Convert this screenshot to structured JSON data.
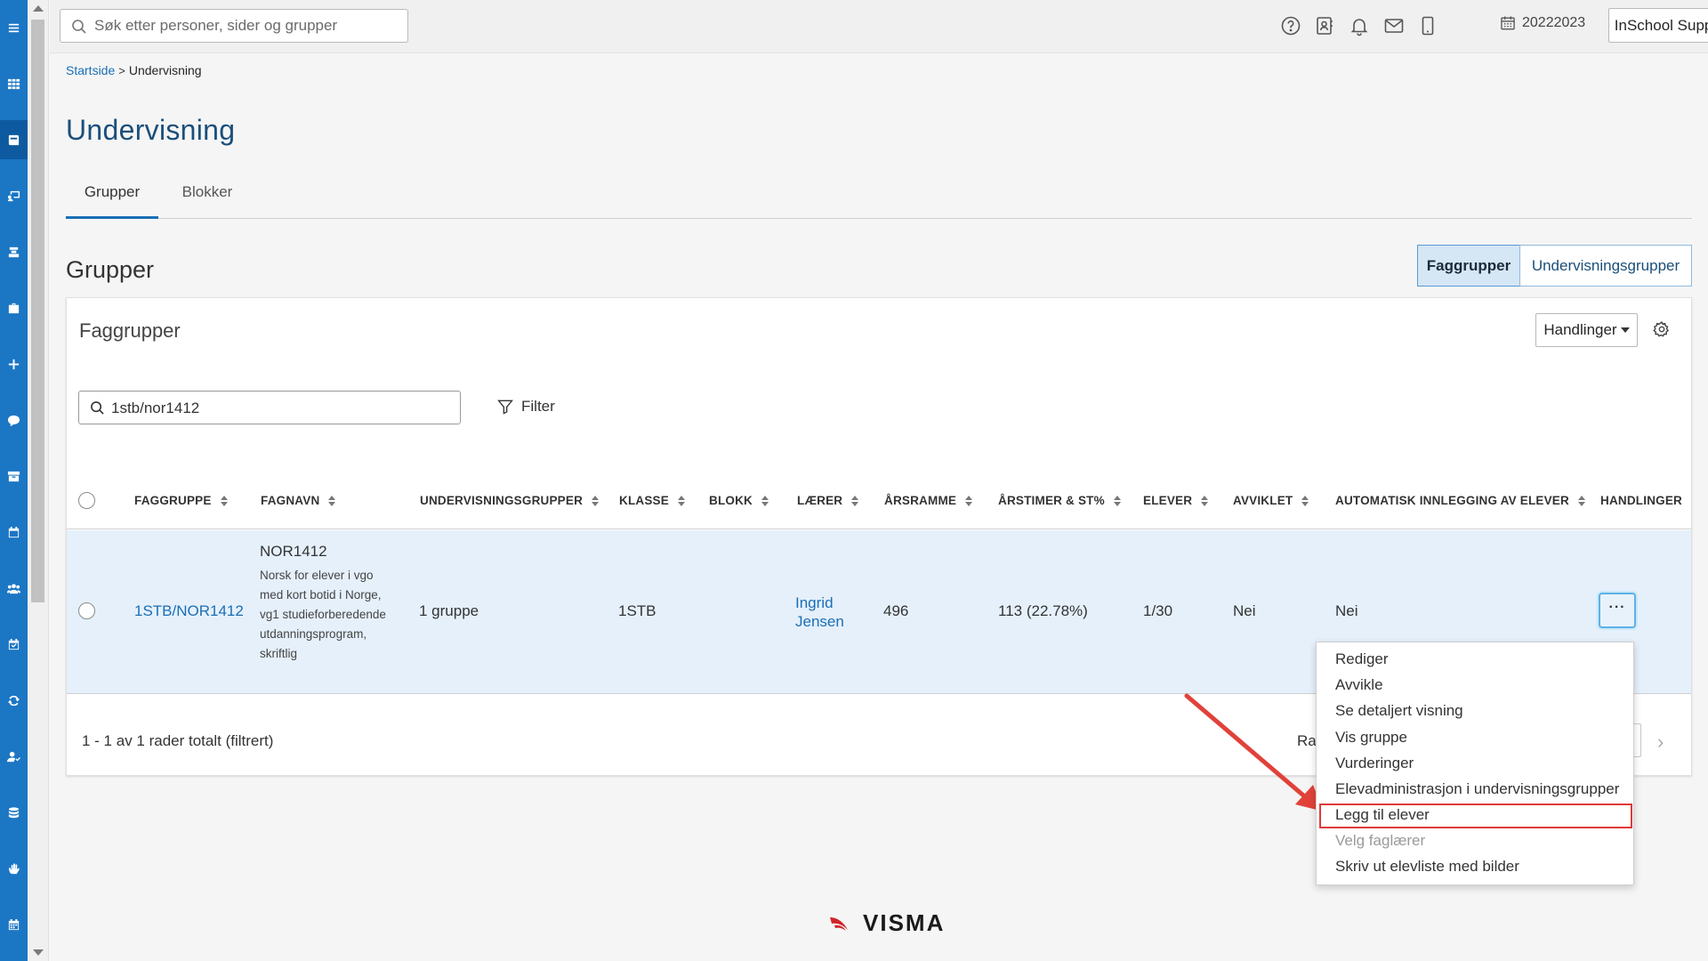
{
  "app": {
    "accent": "#1b76c4",
    "title_color": "#1b4f7a"
  },
  "rail": {
    "items": [
      {
        "icon": "menu-icon"
      },
      {
        "icon": "apps-grid-icon"
      },
      {
        "icon": "book-icon",
        "active": true
      },
      {
        "icon": "presentation-icon"
      },
      {
        "icon": "student-icon"
      },
      {
        "icon": "briefcase-icon"
      },
      {
        "icon": "plus-icon"
      },
      {
        "icon": "chat-icon"
      },
      {
        "icon": "archive-icon"
      },
      {
        "icon": "calendar-icon"
      },
      {
        "icon": "group-icon"
      },
      {
        "icon": "calendar-check-icon"
      },
      {
        "icon": "sync-icon"
      },
      {
        "icon": "user-check-icon"
      },
      {
        "icon": "database-icon"
      },
      {
        "icon": "hand-icon"
      },
      {
        "icon": "calendar-grid-icon"
      }
    ]
  },
  "topbar": {
    "search_placeholder": "Søk etter personer, sider og grupper",
    "icons": [
      "help-icon",
      "contact-card-icon",
      "bell-icon",
      "mail-icon",
      "mobile-icon",
      "calendar-icon"
    ],
    "school_year": "20222023",
    "user_label": "InSchool Support"
  },
  "breadcrumb": {
    "home": "Startside",
    "separator": ">",
    "current": "Undervisning"
  },
  "page": {
    "title": "Undervisning",
    "tabs": [
      {
        "label": "Grupper",
        "active": true
      },
      {
        "label": "Blokker",
        "active": false
      }
    ],
    "section_title": "Grupper",
    "segments": [
      {
        "label": "Faggrupper",
        "active": true
      },
      {
        "label": "Undervisningsgrupper",
        "active": false
      }
    ]
  },
  "card": {
    "title": "Faggrupper",
    "actions_label": "Handlinger",
    "search_value": "1stb/nor1412",
    "filter_label": "Filter",
    "columns": [
      "FAGGRUPPE",
      "FAGNAVN",
      "UNDERVISNINGSGRUPPER",
      "KLASSE",
      "BLOKK",
      "LÆRER",
      "ÅRSRAMME",
      "ÅRSTIMER & ST%",
      "ELEVER",
      "AVVIKLET",
      "AUTOMATISK INNLEGGING AV ELEVER",
      "HANDLINGER"
    ],
    "row": {
      "faggruppe": "1STB/NOR1412",
      "fagkode": "NOR1412",
      "fagnavn": "Norsk for elever i vgo med kort botid i Norge, vg1 studieforberedende utdanningsprogram, skriftlig",
      "undervisningsgrupper": "1 gruppe",
      "klasse": "1STB",
      "blokk": "",
      "laerer": "Ingrid Jensen",
      "arsramme": "496",
      "arstimer": "113 (22.78%)",
      "elever": "1/30",
      "avviklet": "Nei",
      "automatisk": "Nei",
      "more_label": "···"
    },
    "total_text": "1 - 1 av 1 rader totalt (filtrert)",
    "rows_per_page_label_partial": "Ra"
  },
  "menu": {
    "items": [
      {
        "label": "Rediger"
      },
      {
        "label": "Avvikle"
      },
      {
        "label": "Se detaljert visning"
      },
      {
        "label": "Vis gruppe"
      },
      {
        "label": "Vurderinger"
      },
      {
        "label": "Elevadministrasjon i undervisningsgrupper"
      },
      {
        "label": "Legg til elever",
        "highlighted": true
      },
      {
        "label": "Velg faglærer",
        "disabled": true
      },
      {
        "label": "Skriv ut elevliste med bilder"
      }
    ]
  },
  "footer": {
    "logo_text": "VISMA",
    "logo_color": "#d2232a"
  }
}
